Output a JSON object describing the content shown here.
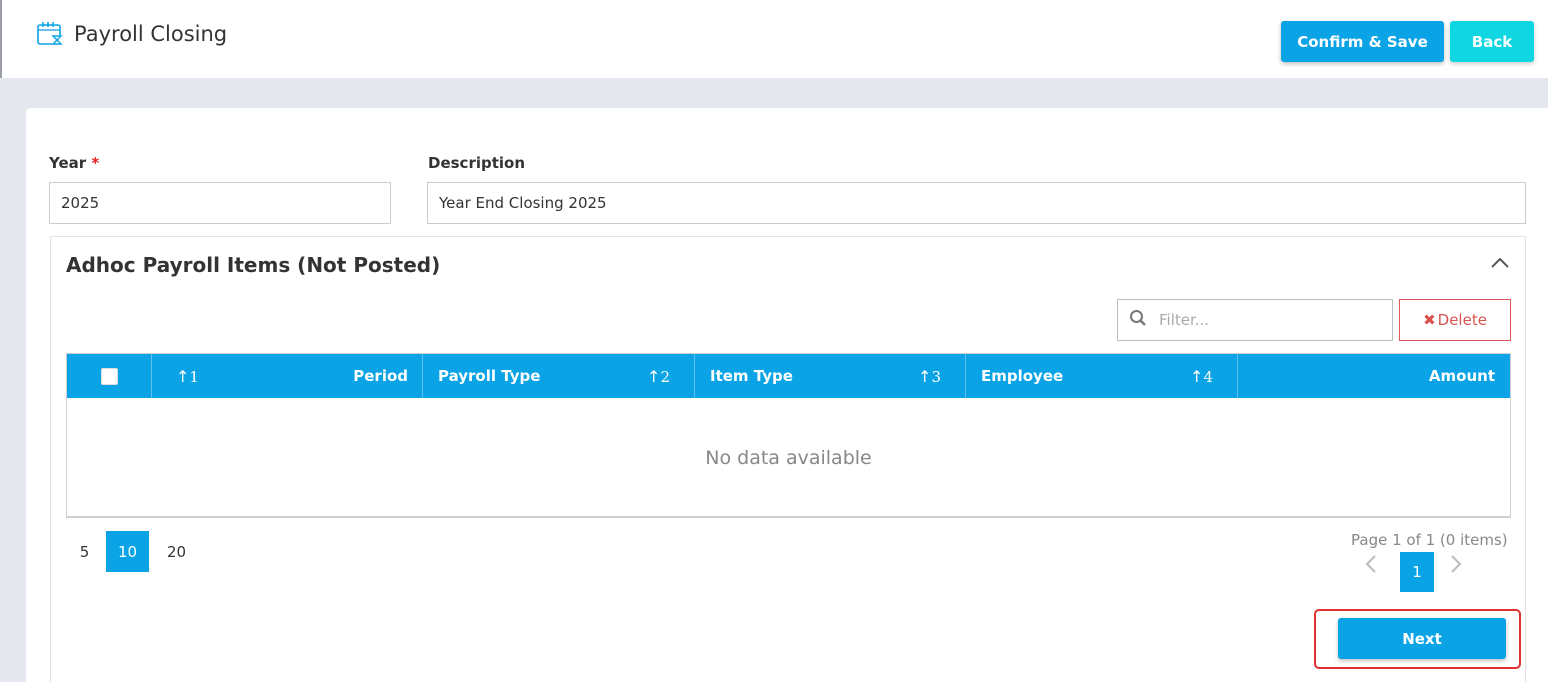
{
  "header": {
    "title": "Payroll Closing",
    "title_icon": "calendar-clock-icon",
    "confirm_label": "Confirm & Save",
    "back_label": "Back"
  },
  "form": {
    "year_label": "Year",
    "year_required_mark": "*",
    "year_value": "2025",
    "description_label": "Description",
    "description_value": "Year End Closing 2025"
  },
  "panel": {
    "title": "Adhoc Payroll Items (Not Posted)",
    "filter_placeholder": "Filter...",
    "delete_label": "Delete",
    "columns": [
      {
        "sort_order": "1",
        "label": "Period"
      },
      {
        "label": "Payroll Type",
        "sort_order": "2"
      },
      {
        "label": "Item Type",
        "sort_order": "3"
      },
      {
        "label": "Employee",
        "sort_order": "4"
      },
      {
        "label": "Amount"
      }
    ],
    "empty_text": "No data available",
    "page_sizes": [
      "5",
      "10",
      "20"
    ],
    "active_page_size": "10",
    "page_info": "Page 1 of 1 (0 items)",
    "current_page": "1",
    "next_label": "Next"
  },
  "colors": {
    "primary": "#0aa3e6",
    "back": "#10d6e2",
    "danger": "#d9534f"
  }
}
